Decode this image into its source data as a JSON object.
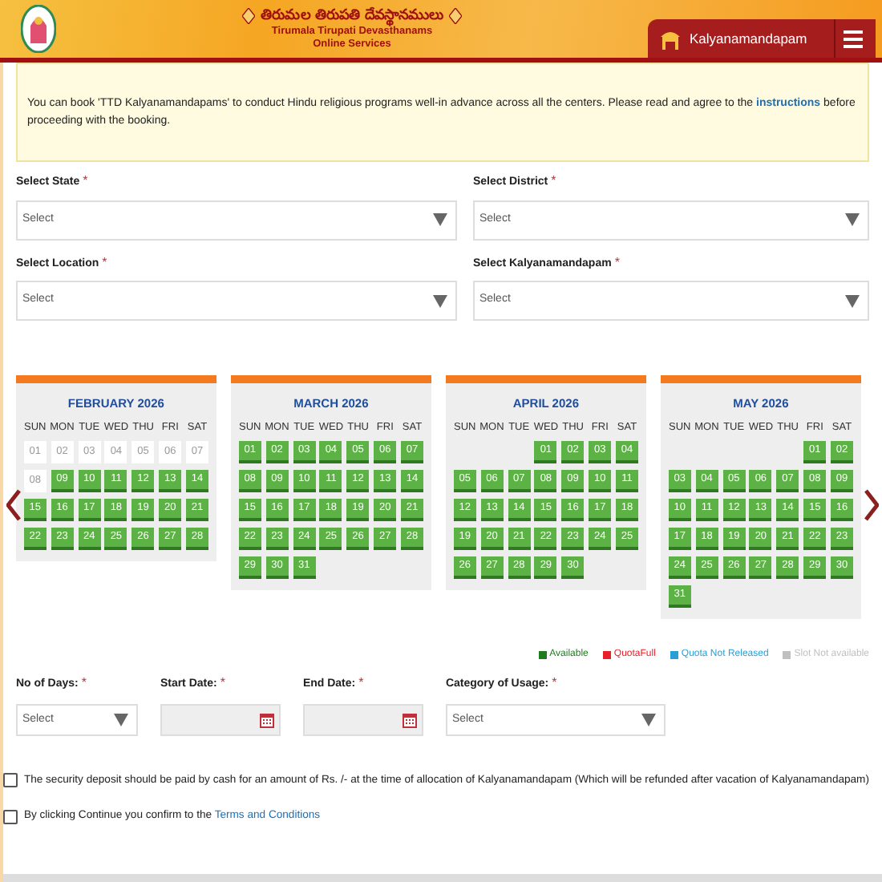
{
  "header": {
    "title_telugu": "తిరుమల తిరుపతి దేవస్థానములు",
    "title": "Tirumala Tirupati Devasthanams",
    "subtitle": "Online Services",
    "section": "Kalyanamandapam"
  },
  "notice": {
    "text": "You can book 'TTD Kalyanamandapams' to conduct Hindu religious programs well-in advance across all the centers. Please read and agree to the",
    "link": "instructions",
    "text_after": "before proceeding with the booking."
  },
  "fields": [
    {
      "label": "Select State",
      "required": "*",
      "placeholder": "Select"
    },
    {
      "label": "Select District",
      "required": "*",
      "placeholder": "Select"
    },
    {
      "label": "Select Location",
      "required": "*",
      "placeholder": "Select"
    },
    {
      "label": "Select Kalyanamandapam",
      "required": "*",
      "placeholder": "Select"
    }
  ],
  "calendars": [
    {
      "title": "FEBRUARY 2026",
      "weekdays": [
        "SUN",
        "MON",
        "TUE",
        "WED",
        "THU",
        "FRI",
        "SAT"
      ],
      "cells": [
        {
          "kind": "day",
          "day": "01",
          "available": false
        },
        {
          "kind": "day",
          "day": "02",
          "available": false
        },
        {
          "kind": "day",
          "day": "03",
          "available": false
        },
        {
          "kind": "day",
          "day": "04",
          "available": false
        },
        {
          "kind": "day",
          "day": "05",
          "available": false
        },
        {
          "kind": "day",
          "day": "06",
          "available": false
        },
        {
          "kind": "day",
          "day": "07",
          "available": false
        },
        {
          "kind": "day",
          "day": "08",
          "available": false
        },
        {
          "kind": "day",
          "day": "09",
          "available": true
        },
        {
          "kind": "day",
          "day": "10",
          "available": true
        },
        {
          "kind": "day",
          "day": "11",
          "available": true
        },
        {
          "kind": "day",
          "day": "12",
          "available": true
        },
        {
          "kind": "day",
          "day": "13",
          "available": true
        },
        {
          "kind": "day",
          "day": "14",
          "available": true
        },
        {
          "kind": "day",
          "day": "15",
          "available": true
        },
        {
          "kind": "day",
          "day": "16",
          "available": true
        },
        {
          "kind": "day",
          "day": "17",
          "available": true
        },
        {
          "kind": "day",
          "day": "18",
          "available": true
        },
        {
          "kind": "day",
          "day": "19",
          "available": true
        },
        {
          "kind": "day",
          "day": "20",
          "available": true
        },
        {
          "kind": "day",
          "day": "21",
          "available": true
        },
        {
          "kind": "day",
          "day": "22",
          "available": true
        },
        {
          "kind": "day",
          "day": "23",
          "available": true
        },
        {
          "kind": "day",
          "day": "24",
          "available": true
        },
        {
          "kind": "day",
          "day": "25",
          "available": true
        },
        {
          "kind": "day",
          "day": "26",
          "available": true
        },
        {
          "kind": "day",
          "day": "27",
          "available": true
        },
        {
          "kind": "day",
          "day": "28",
          "available": true
        }
      ]
    },
    {
      "title": "MARCH 2026",
      "weekdays": [
        "SUN",
        "MON",
        "TUE",
        "WED",
        "THU",
        "FRI",
        "SAT"
      ],
      "cells": [
        {
          "kind": "day",
          "day": "01",
          "available": true
        },
        {
          "kind": "day",
          "day": "02",
          "available": true
        },
        {
          "kind": "day",
          "day": "03",
          "available": true
        },
        {
          "kind": "day",
          "day": "04",
          "available": true
        },
        {
          "kind": "day",
          "day": "05",
          "available": true
        },
        {
          "kind": "day",
          "day": "06",
          "available": true
        },
        {
          "kind": "day",
          "day": "07",
          "available": true
        },
        {
          "kind": "day",
          "day": "08",
          "available": true
        },
        {
          "kind": "day",
          "day": "09",
          "available": true
        },
        {
          "kind": "day",
          "day": "10",
          "available": true
        },
        {
          "kind": "day",
          "day": "11",
          "available": true
        },
        {
          "kind": "day",
          "day": "12",
          "available": true
        },
        {
          "kind": "day",
          "day": "13",
          "available": true
        },
        {
          "kind": "day",
          "day": "14",
          "available": true
        },
        {
          "kind": "day",
          "day": "15",
          "available": true
        },
        {
          "kind": "day",
          "day": "16",
          "available": true
        },
        {
          "kind": "day",
          "day": "17",
          "available": true
        },
        {
          "kind": "day",
          "day": "18",
          "available": true
        },
        {
          "kind": "day",
          "day": "19",
          "available": true
        },
        {
          "kind": "day",
          "day": "20",
          "available": true
        },
        {
          "kind": "day",
          "day": "21",
          "available": true
        },
        {
          "kind": "day",
          "day": "22",
          "available": true
        },
        {
          "kind": "day",
          "day": "23",
          "available": true
        },
        {
          "kind": "day",
          "day": "24",
          "available": true
        },
        {
          "kind": "day",
          "day": "25",
          "available": true
        },
        {
          "kind": "day",
          "day": "26",
          "available": true
        },
        {
          "kind": "day",
          "day": "27",
          "available": true
        },
        {
          "kind": "day",
          "day": "28",
          "available": true
        },
        {
          "kind": "day",
          "day": "29",
          "available": true
        },
        {
          "kind": "day",
          "day": "30",
          "available": true
        },
        {
          "kind": "day",
          "day": "31",
          "available": true
        }
      ]
    },
    {
      "title": "APRIL 2026",
      "weekdays": [
        "SUN",
        "MON",
        "TUE",
        "WED",
        "THU",
        "FRI",
        "SAT"
      ],
      "cells": [
        {
          "kind": "blank"
        },
        {
          "kind": "blank"
        },
        {
          "kind": "blank"
        },
        {
          "kind": "day",
          "day": "01",
          "available": true
        },
        {
          "kind": "day",
          "day": "02",
          "available": true
        },
        {
          "kind": "day",
          "day": "03",
          "available": true
        },
        {
          "kind": "day",
          "day": "04",
          "available": true
        },
        {
          "kind": "day",
          "day": "05",
          "available": true
        },
        {
          "kind": "day",
          "day": "06",
          "available": true
        },
        {
          "kind": "day",
          "day": "07",
          "available": true
        },
        {
          "kind": "day",
          "day": "08",
          "available": true
        },
        {
          "kind": "day",
          "day": "09",
          "available": true
        },
        {
          "kind": "day",
          "day": "10",
          "available": true
        },
        {
          "kind": "day",
          "day": "11",
          "available": true
        },
        {
          "kind": "day",
          "day": "12",
          "available": true
        },
        {
          "kind": "day",
          "day": "13",
          "available": true
        },
        {
          "kind": "day",
          "day": "14",
          "available": true
        },
        {
          "kind": "day",
          "day": "15",
          "available": true
        },
        {
          "kind": "day",
          "day": "16",
          "available": true
        },
        {
          "kind": "day",
          "day": "17",
          "available": true
        },
        {
          "kind": "day",
          "day": "18",
          "available": true
        },
        {
          "kind": "day",
          "day": "19",
          "available": true
        },
        {
          "kind": "day",
          "day": "20",
          "available": true
        },
        {
          "kind": "day",
          "day": "21",
          "available": true
        },
        {
          "kind": "day",
          "day": "22",
          "available": true
        },
        {
          "kind": "day",
          "day": "23",
          "available": true
        },
        {
          "kind": "day",
          "day": "24",
          "available": true
        },
        {
          "kind": "day",
          "day": "25",
          "available": true
        },
        {
          "kind": "day",
          "day": "26",
          "available": true
        },
        {
          "kind": "day",
          "day": "27",
          "available": true
        },
        {
          "kind": "day",
          "day": "28",
          "available": true
        },
        {
          "kind": "day",
          "day": "29",
          "available": true
        },
        {
          "kind": "day",
          "day": "30",
          "available": true
        }
      ]
    },
    {
      "title": "MAY 2026",
      "weekdays": [
        "SUN",
        "MON",
        "TUE",
        "WED",
        "THU",
        "FRI",
        "SAT"
      ],
      "cells": [
        {
          "kind": "blank"
        },
        {
          "kind": "blank"
        },
        {
          "kind": "blank"
        },
        {
          "kind": "blank"
        },
        {
          "kind": "blank"
        },
        {
          "kind": "day",
          "day": "01",
          "available": true
        },
        {
          "kind": "day",
          "day": "02",
          "available": true
        },
        {
          "kind": "day",
          "day": "03",
          "available": true
        },
        {
          "kind": "day",
          "day": "04",
          "available": true
        },
        {
          "kind": "day",
          "day": "05",
          "available": true
        },
        {
          "kind": "day",
          "day": "06",
          "available": true
        },
        {
          "kind": "day",
          "day": "07",
          "available": true
        },
        {
          "kind": "day",
          "day": "08",
          "available": true
        },
        {
          "kind": "day",
          "day": "09",
          "available": true
        },
        {
          "kind": "day",
          "day": "10",
          "available": true
        },
        {
          "kind": "day",
          "day": "11",
          "available": true
        },
        {
          "kind": "day",
          "day": "12",
          "available": true
        },
        {
          "kind": "day",
          "day": "13",
          "available": true
        },
        {
          "kind": "day",
          "day": "14",
          "available": true
        },
        {
          "kind": "day",
          "day": "15",
          "available": true
        },
        {
          "kind": "day",
          "day": "16",
          "available": true
        },
        {
          "kind": "day",
          "day": "17",
          "available": true
        },
        {
          "kind": "day",
          "day": "18",
          "available": true
        },
        {
          "kind": "day",
          "day": "19",
          "available": true
        },
        {
          "kind": "day",
          "day": "20",
          "available": true
        },
        {
          "kind": "day",
          "day": "21",
          "available": true
        },
        {
          "kind": "day",
          "day": "22",
          "available": true
        },
        {
          "kind": "day",
          "day": "23",
          "available": true
        },
        {
          "kind": "day",
          "day": "24",
          "available": true
        },
        {
          "kind": "day",
          "day": "25",
          "available": true
        },
        {
          "kind": "day",
          "day": "26",
          "available": true
        },
        {
          "kind": "day",
          "day": "27",
          "available": true
        },
        {
          "kind": "day",
          "day": "28",
          "available": true
        },
        {
          "kind": "day",
          "day": "29",
          "available": true
        },
        {
          "kind": "day",
          "day": "30",
          "available": true
        },
        {
          "kind": "day",
          "day": "31",
          "available": true
        }
      ]
    }
  ],
  "legend": [
    {
      "label": "Available",
      "color": "#1e7b1e"
    },
    {
      "label": "QuotaFull",
      "color": "#e8202a"
    },
    {
      "label": "Quota Not Released",
      "color": "#2a9fd6"
    },
    {
      "label": "Slot Not available",
      "color": "#c0c0c0"
    }
  ],
  "booking_fields": [
    {
      "kind": "select",
      "label": "No of Days:",
      "required": "*",
      "placeholder": "Select"
    },
    {
      "kind": "date",
      "label": "Start Date:",
      "required": "*"
    },
    {
      "kind": "date",
      "label": "End Date:",
      "required": "*"
    },
    {
      "kind": "select",
      "label": "Category of Usage:",
      "required": "*",
      "placeholder": "Select"
    }
  ],
  "agreements": [
    {
      "text": "The security deposit should be paid by cash for an amount of Rs. /- at the time of allocation of Kalyanamandapam (Which will be refunded after vacation of Kalyanamandapam)",
      "checked": false
    },
    {
      "text": "By clicking Continue you confirm to the",
      "link": "Terms and Conditions",
      "checked": false
    }
  ]
}
